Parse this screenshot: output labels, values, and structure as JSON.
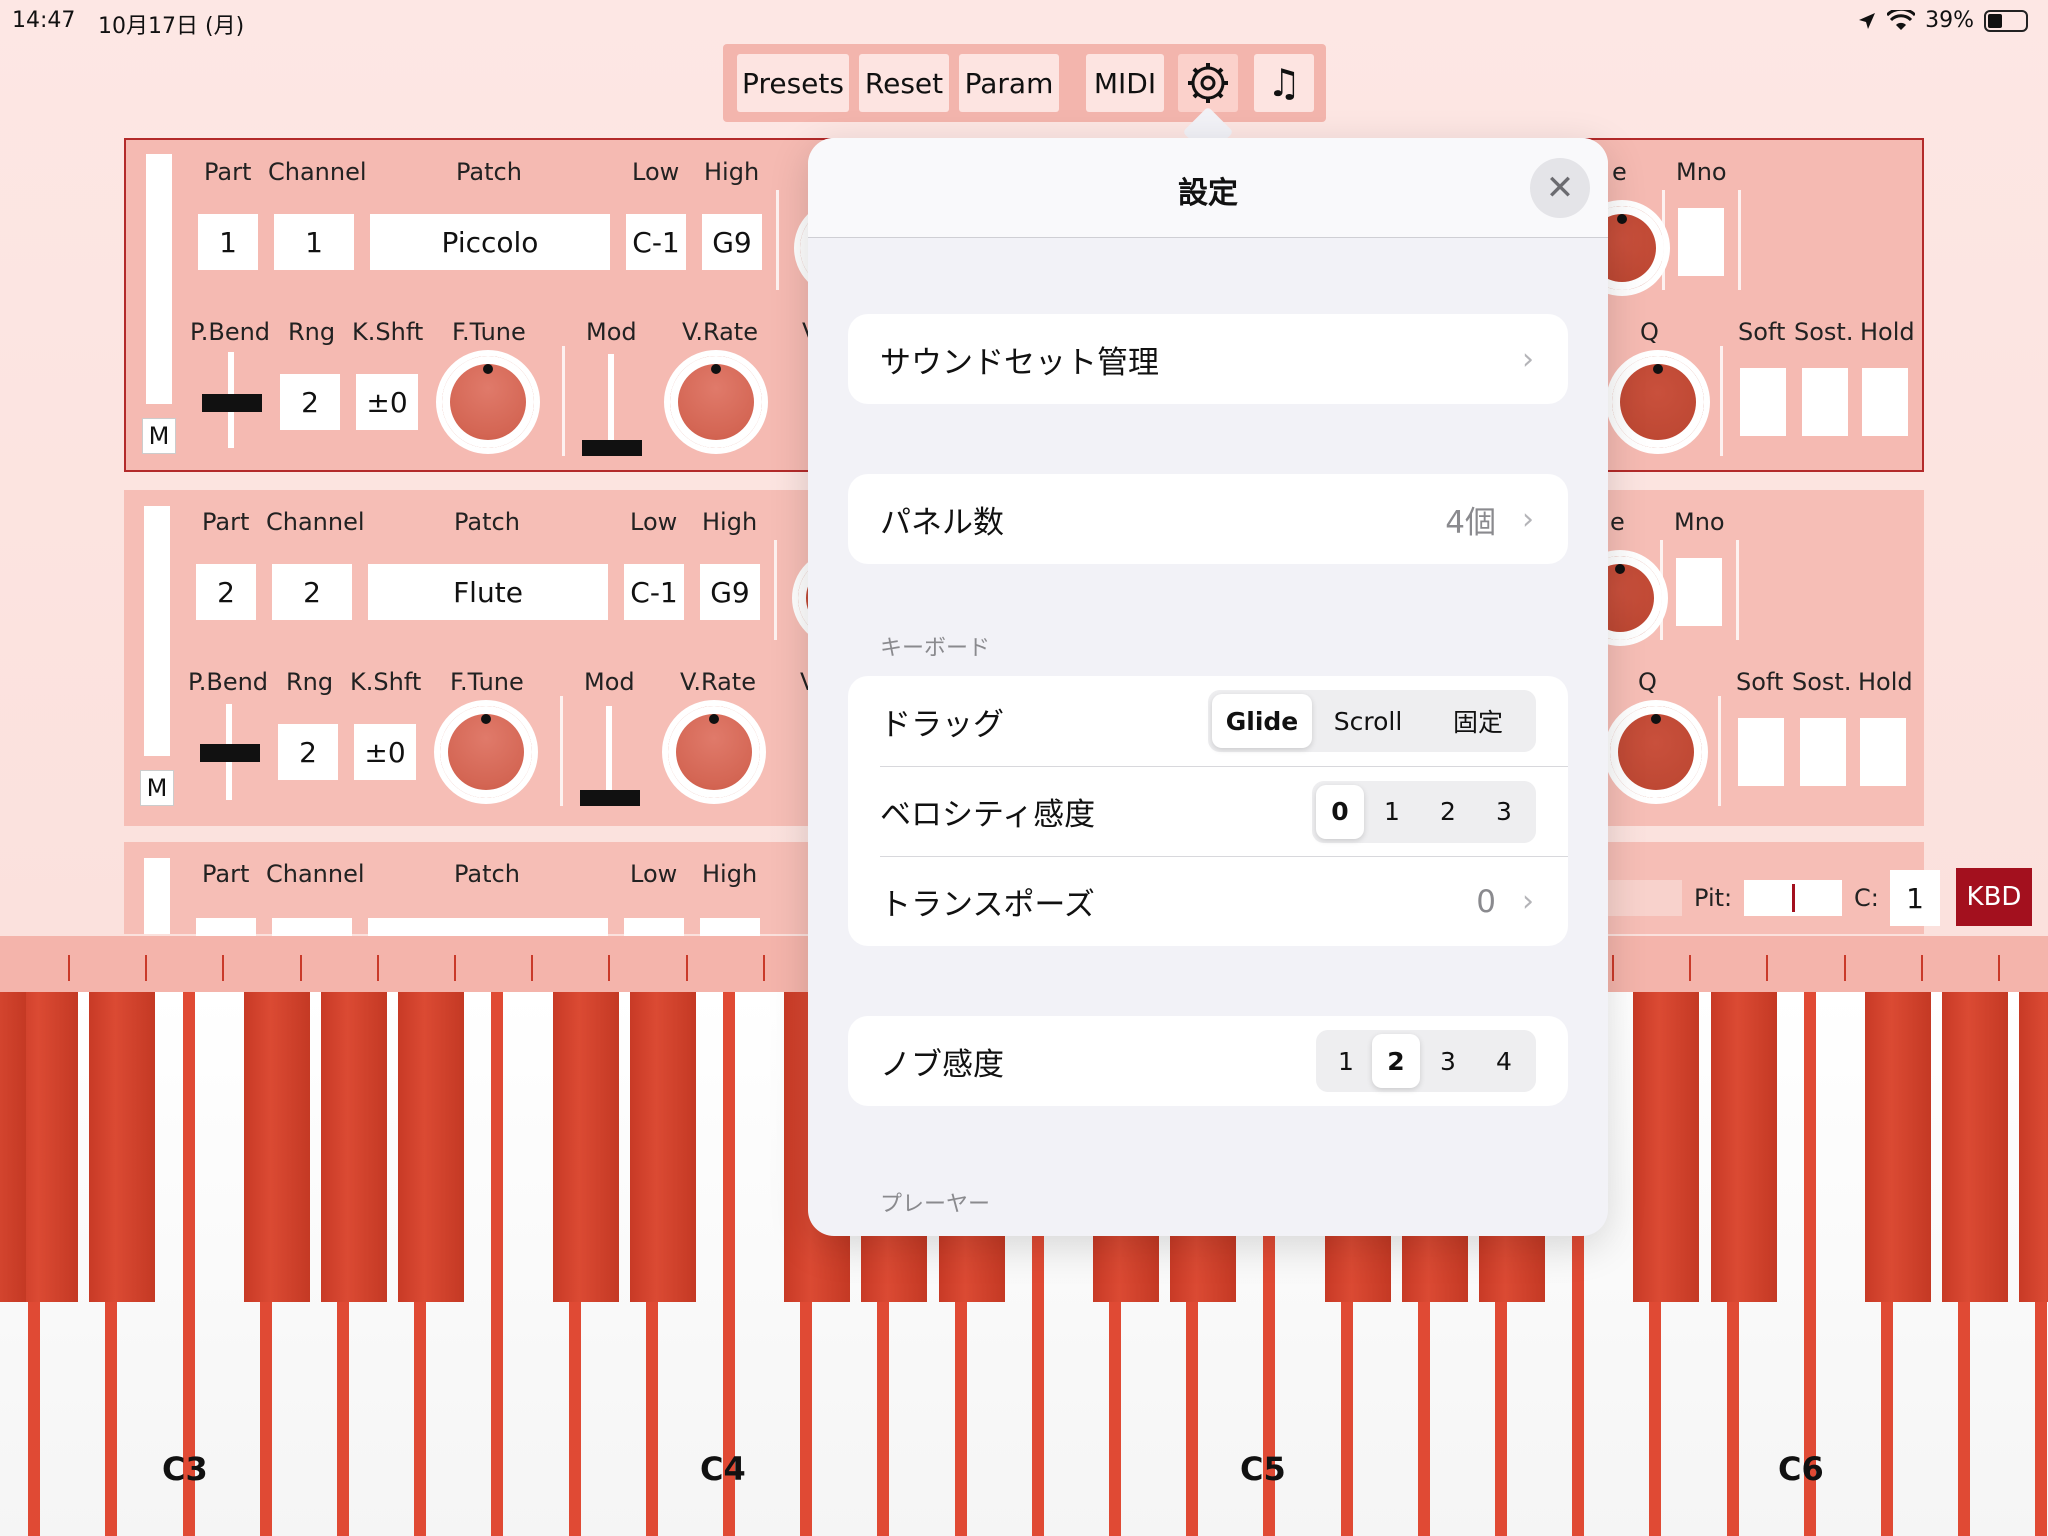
{
  "status": {
    "time": "14:47",
    "date": "10月17日 (月)",
    "battery": "39%"
  },
  "toolbar": {
    "presets": "Presets",
    "reset": "Reset",
    "param": "Param",
    "midi": "MIDI",
    "gear_icon": "gear-icon",
    "music_icon": "music-note-icon",
    "music_glyph": "♫"
  },
  "panel_labels": {
    "part": "Part",
    "channel": "Channel",
    "patch": "Patch",
    "low": "Low",
    "high": "High",
    "pbend": "P.Bend",
    "rng": "Rng",
    "kshft": "K.Shft",
    "ftune": "F.Tune",
    "mod": "Mod",
    "vrate": "V.Rate",
    "v": "V",
    "e": "e",
    "mno": "Mno",
    "q": "Q",
    "soft": "Soft",
    "sost": "Sost.",
    "hold": "Hold",
    "m": "M"
  },
  "panels": [
    {
      "part": "1",
      "channel": "1",
      "patch": "Piccolo",
      "low": "C-1",
      "high": "G9",
      "rng": "2",
      "kshft": "±0"
    },
    {
      "part": "2",
      "channel": "2",
      "patch": "Flute",
      "low": "C-1",
      "high": "G9",
      "rng": "2",
      "kshft": "±0"
    }
  ],
  "kbd_bar": {
    "pit_label": "Pit:",
    "c_label": "C:",
    "c_value": "1",
    "kbd_button": "KBD"
  },
  "keyboard": {
    "labels": [
      "C3",
      "C4",
      "C5",
      "C6"
    ]
  },
  "settings": {
    "title": "設定",
    "close_glyph": "✕",
    "sound_set": "サウンドセット管理",
    "panel_count_label": "パネル数",
    "panel_count_value": "4個",
    "keyboard_header": "キーボード",
    "drag_label": "ドラッグ",
    "drag_options": [
      "Glide",
      "Scroll",
      "固定"
    ],
    "drag_selected": "Glide",
    "velocity_label": "ベロシティ感度",
    "velocity_options": [
      "0",
      "1",
      "2",
      "3"
    ],
    "velocity_selected": "0",
    "transpose_label": "トランスポーズ",
    "transpose_value": "0",
    "knob_label": "ノブ感度",
    "knob_options": [
      "1",
      "2",
      "3",
      "4"
    ],
    "knob_selected": "2",
    "player_header": "プレーヤー",
    "chevron": "›"
  },
  "colors": {
    "accent": "#a3101e",
    "key_red": "#e04a34",
    "panel": "#f6beb6"
  }
}
